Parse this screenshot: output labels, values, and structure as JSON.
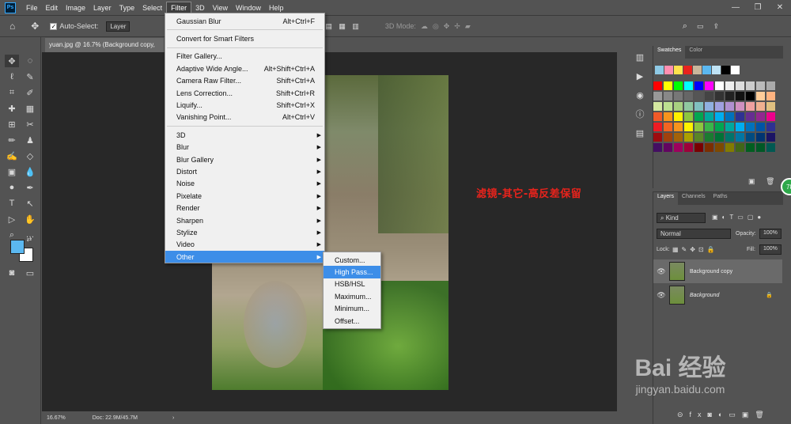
{
  "menubar": {
    "logo": "Ps",
    "items": [
      "File",
      "Edit",
      "Image",
      "Layer",
      "Type",
      "Select",
      "Filter",
      "3D",
      "View",
      "Window",
      "Help"
    ],
    "active": "Filter",
    "window_controls": [
      "—",
      "❐",
      "✕"
    ]
  },
  "options": {
    "auto_select_label": "Auto-Select:",
    "auto_select_value": "Layer",
    "mode_3d": "3D Mode:"
  },
  "document": {
    "tab_title": "yuan.jpg @ 16.7% (Background copy,",
    "zoom": "16.67%",
    "doc_info": "Doc: 22.9M/45.7M"
  },
  "caption": "滤镜-其它-高反差保留",
  "filter_menu": {
    "items": [
      {
        "label": "Gaussian Blur",
        "shortcut": "Alt+Ctrl+F"
      },
      {
        "sep": true
      },
      {
        "label": "Convert for Smart Filters"
      },
      {
        "sep": true
      },
      {
        "label": "Filter Gallery..."
      },
      {
        "label": "Adaptive Wide Angle...",
        "shortcut": "Alt+Shift+Ctrl+A"
      },
      {
        "label": "Camera Raw Filter...",
        "shortcut": "Shift+Ctrl+A"
      },
      {
        "label": "Lens Correction...",
        "shortcut": "Shift+Ctrl+R"
      },
      {
        "label": "Liquify...",
        "shortcut": "Shift+Ctrl+X"
      },
      {
        "label": "Vanishing Point...",
        "shortcut": "Alt+Ctrl+V"
      },
      {
        "sep": true
      },
      {
        "label": "3D",
        "sub": true
      },
      {
        "label": "Blur",
        "sub": true
      },
      {
        "label": "Blur Gallery",
        "sub": true
      },
      {
        "label": "Distort",
        "sub": true
      },
      {
        "label": "Noise",
        "sub": true
      },
      {
        "label": "Pixelate",
        "sub": true
      },
      {
        "label": "Render",
        "sub": true
      },
      {
        "label": "Sharpen",
        "sub": true
      },
      {
        "label": "Stylize",
        "sub": true
      },
      {
        "label": "Video",
        "sub": true
      },
      {
        "label": "Other",
        "sub": true,
        "highlight": true
      }
    ]
  },
  "other_submenu": {
    "items": [
      {
        "label": "Custom..."
      },
      {
        "label": "High Pass...",
        "highlight": true
      },
      {
        "label": "HSB/HSL"
      },
      {
        "label": "Maximum..."
      },
      {
        "label": "Minimum..."
      },
      {
        "label": "Offset..."
      }
    ]
  },
  "swatches_panel": {
    "tabs": [
      "Swatches",
      "Color"
    ],
    "active": "Swatches"
  },
  "layers_panel": {
    "tabs": [
      "Layers",
      "Channels",
      "Paths"
    ],
    "active": "Layers",
    "kind_label": "Kind",
    "blend_mode": "Normal",
    "opacity_label": "Opacity:",
    "opacity_value": "100%",
    "lock_label": "Lock:",
    "fill_label": "Fill:",
    "fill_value": "100%",
    "layers": [
      {
        "name": "Background copy",
        "selected": true
      },
      {
        "name": "Background",
        "locked": true
      }
    ]
  },
  "badge": "78",
  "watermark": {
    "brand": "Bai 经验",
    "url": "jingyan.baidu.com"
  },
  "colors": {
    "foreground": "#5bb8f0",
    "background": "#ffffff",
    "highlight": "#3d8ee8",
    "caption": "#e8231c"
  }
}
